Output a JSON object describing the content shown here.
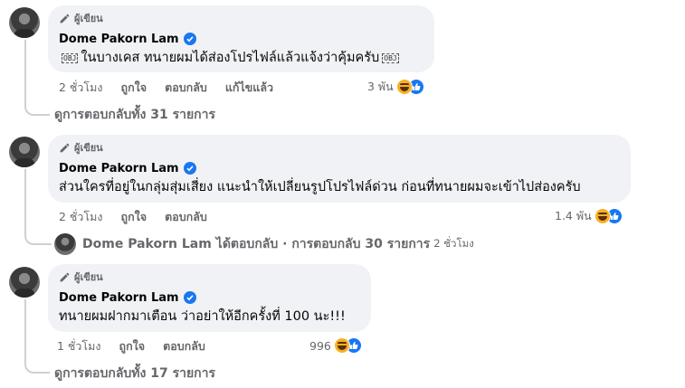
{
  "comments": [
    {
      "author_badge": "ผู้เขียน",
      "author": "Dome Pakorn Lam",
      "obj_marker": "OBJ",
      "text": "ในบางเคส ทนายผมได้ส่องโปรไฟล์แล้วแจ้งว่าคุ้มครับ",
      "time": "2 ชั่วโมง",
      "like_label": "ถูกใจ",
      "reply_label": "ตอบกลับ",
      "edited_label": "แก้ไขแล้ว",
      "reaction_count": "3 พัน",
      "view_replies": "ดูการตอบกลับทั้ง 31 รายการ"
    },
    {
      "author_badge": "ผู้เขียน",
      "author": "Dome Pakorn Lam",
      "text": "ส่วนใครที่อยู่ในกลุ่มสุ่มเสี่ยง แนะนำให้เปลี่ยนรูปโปรไฟล์ด่วน ก่อนที่ทนายผมจะเข้าไปส่องครับ",
      "time": "2 ชั่วโมง",
      "like_label": "ถูกใจ",
      "reply_label": "ตอบกลับ",
      "reaction_count": "1.4 พัน",
      "reply_preview": {
        "name": "Dome Pakorn Lam",
        "action": "ได้ตอบกลับ · การตอบกลับ 30 รายการ",
        "time": "2 ชั่วโมง"
      }
    },
    {
      "author_badge": "ผู้เขียน",
      "author": "Dome Pakorn Lam",
      "text": "ทนายผมฝากมาเตือน ว่าอย่าให้อีกครั้งที่ 100 นะ!!!",
      "time": "1 ชั่วโมง",
      "like_label": "ถูกใจ",
      "reply_label": "ตอบกลับ",
      "reaction_count": "996",
      "view_replies": "ดูการตอบกลับทั้ง 17 รายการ"
    }
  ],
  "colors": {
    "bubble": "#f0f2f5",
    "verified": "#1877f2",
    "secondary_text": "#65676b",
    "haha": "#f7b125"
  },
  "icons": [
    "pencil-icon",
    "verified-badge-icon",
    "haha-reaction-icon",
    "like-reaction-icon"
  ]
}
